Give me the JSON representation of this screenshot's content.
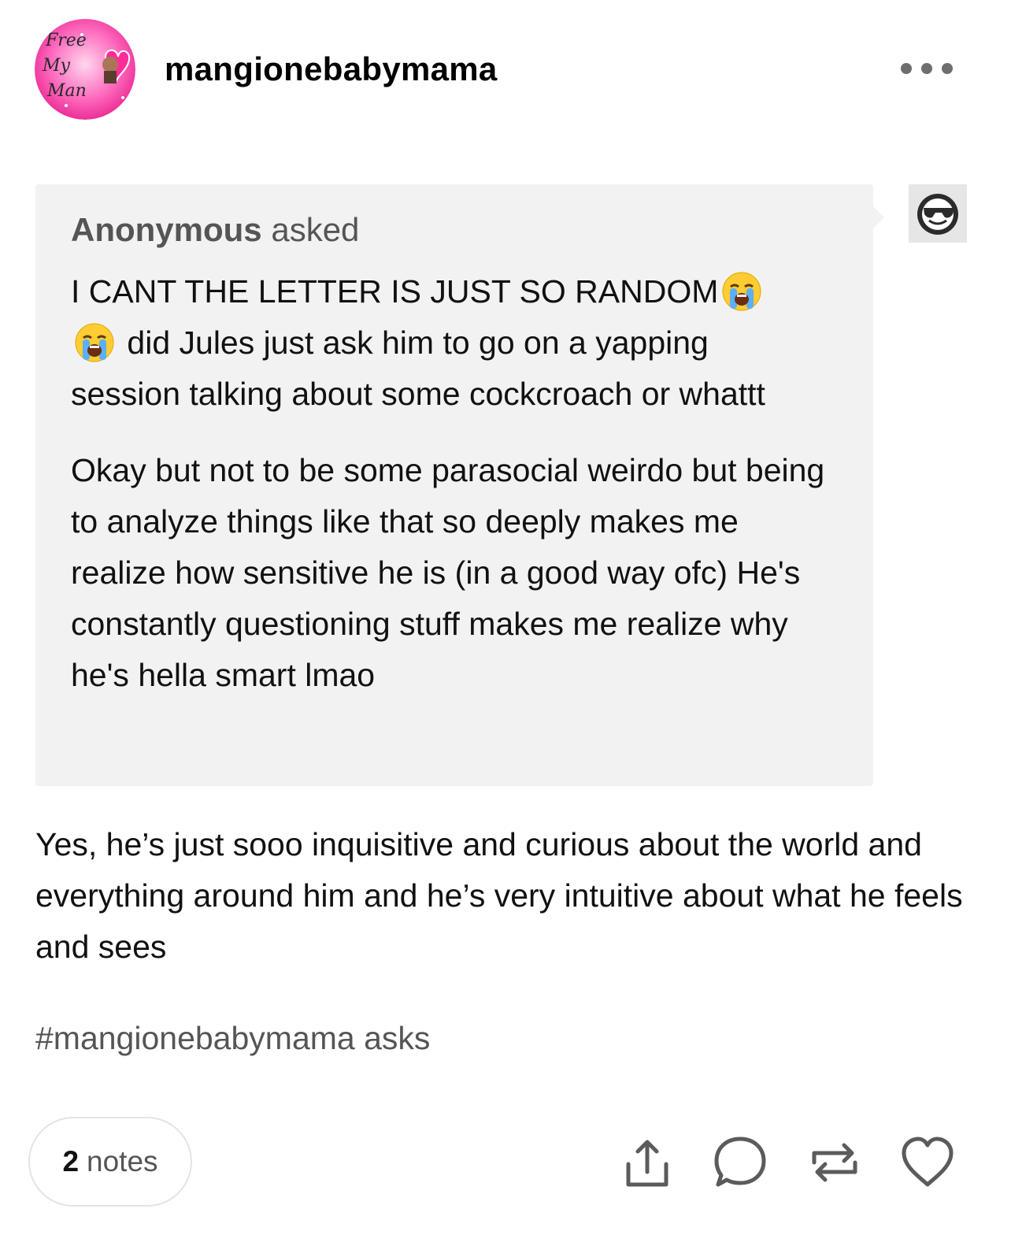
{
  "post": {
    "username": "mangionebabymama",
    "avatar_text": [
      "Free",
      "My",
      "Man"
    ],
    "more_icon": "ellipsis-icon"
  },
  "ask": {
    "asker": "Anonymous",
    "asked_label": "asked",
    "line1_before": "I CANT THE LETTER IS JUST SO RANDOM",
    "line1_after": "did Jules just ask him to go on a yapping session talking about some cockcroach or whattt",
    "paragraph2": "Okay but not to be some parasocial weirdo but being to analyze things like that so deeply makes me realize how sensitive he is (in a good way ofc) He's constantly questioning stuff makes me realize why he's hella smart lmao",
    "emoji": "loudly-crying-face-icon",
    "asker_avatar_icon": "sunglasses-face-icon"
  },
  "answer": {
    "text": "Yes, he’s just sooo inquisitive and curious about the world and everything around him and he’s very intuitive about what he feels and sees"
  },
  "tags": {
    "tag1": "#mangionebabymama asks"
  },
  "footer": {
    "notes_count": "2",
    "notes_label": "notes",
    "actions": [
      "share-icon",
      "reply-icon",
      "reblog-icon",
      "like-icon"
    ]
  },
  "colors": {
    "ask_background": "#f2f2f2",
    "muted_text": "#555555",
    "icon_gray": "#6e6e6e",
    "avatar_pink": "#ff4fb0"
  }
}
